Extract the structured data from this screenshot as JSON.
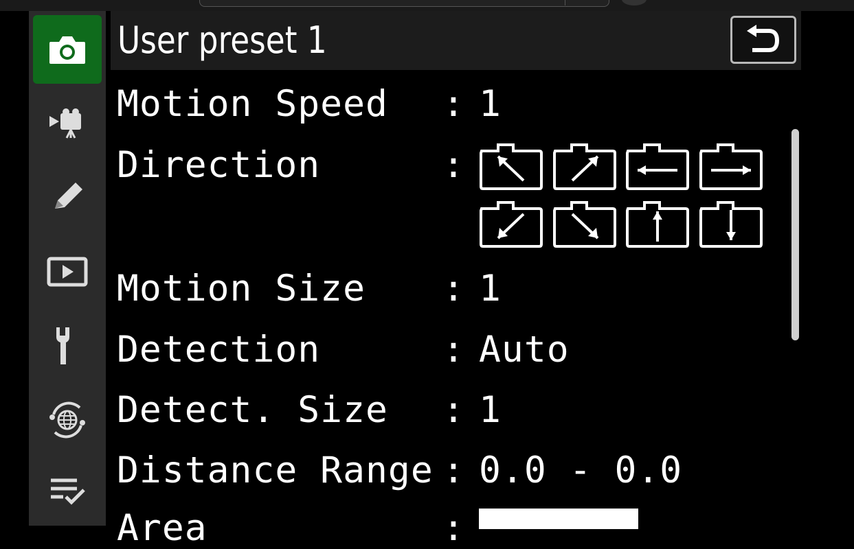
{
  "header": {
    "title": "User preset 1",
    "back_icon": "return-icon"
  },
  "sidebar": {
    "items": [
      {
        "icon": "camera-icon",
        "active": true
      },
      {
        "icon": "movie-camera-icon",
        "active": false
      },
      {
        "icon": "pencil-icon",
        "active": false
      },
      {
        "icon": "playback-icon",
        "active": false
      },
      {
        "icon": "wrench-icon",
        "active": false
      },
      {
        "icon": "network-globe-icon",
        "active": false
      },
      {
        "icon": "my-menu-checklist-icon",
        "active": false
      }
    ],
    "active_color": "#0f6b1c"
  },
  "settings": {
    "motion_speed": {
      "label": "Motion Speed",
      "value": "1"
    },
    "direction": {
      "label": "Direction",
      "arrows": [
        "up-left",
        "up-right",
        "left",
        "right",
        "down-left",
        "down-right",
        "up",
        "down"
      ]
    },
    "motion_size": {
      "label": "Motion Size",
      "value": "1"
    },
    "detection": {
      "label": "Detection",
      "value": "Auto"
    },
    "detect_size": {
      "label": "Detect. Size",
      "value": "1"
    },
    "distance_range": {
      "label": "Distance Range",
      "value": "0.0 - 0.0"
    },
    "area": {
      "label": "Area"
    }
  },
  "separator": ":"
}
